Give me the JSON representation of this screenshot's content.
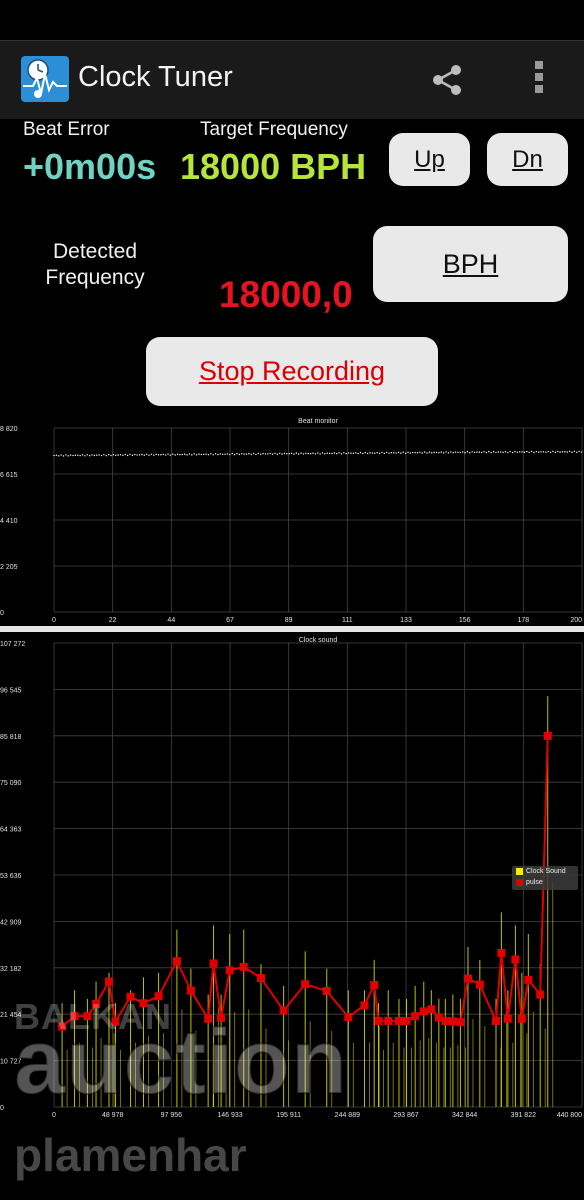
{
  "app": {
    "title": "Clock Tuner",
    "icons": [
      "app-icon",
      "share-icon",
      "overflow-menu-icon"
    ]
  },
  "beat_error": {
    "label": "Beat Error",
    "value": "+0m00s",
    "color": "#6fd3c4"
  },
  "target_frequency": {
    "label": "Target Frequency",
    "value": "18000 BPH",
    "color": "#b5e53a"
  },
  "buttons": {
    "up": "Up",
    "dn": "Dn",
    "bph": "BPH",
    "stop": "Stop Recording"
  },
  "detected_frequency": {
    "label": "Detected Frequency",
    "value": "18000,0",
    "color": "#e8131f"
  },
  "chart_data": [
    {
      "type": "scatter",
      "title": "Beat monitor",
      "y_tick_labels": [
        "0",
        "2 205",
        "4 410",
        "6 615",
        "8 820"
      ],
      "x_tick_labels": [
        "0",
        "22",
        "44",
        "67",
        "89",
        "111",
        "133",
        "156",
        "178",
        "200"
      ],
      "xlim": [
        0,
        200
      ],
      "ylim": [
        0,
        8820
      ],
      "grid": true,
      "series": [
        {
          "color": "#ffffff",
          "x": [
            0,
            20,
            40,
            60,
            80,
            100,
            120,
            140,
            160,
            180,
            200
          ],
          "y": [
            7500,
            7520,
            7540,
            7560,
            7580,
            7600,
            7620,
            7640,
            7660,
            7670,
            7680
          ]
        }
      ]
    },
    {
      "type": "line",
      "title": "Clock sound",
      "y_tick_labels": [
        "0",
        "10 727",
        "21 454",
        "32 182",
        "42 909",
        "53 636",
        "64 363",
        "75 090",
        "85 818",
        "96 545",
        "107 272"
      ],
      "x_tick_labels": [
        "0",
        "48 978",
        "97 956",
        "146 933",
        "195 911",
        "244 889",
        "293 867",
        "342 844",
        "391 822",
        "440 800"
      ],
      "ylim": [
        0,
        107272
      ],
      "xlim": [
        0,
        489778
      ],
      "grid": true,
      "legend": {
        "position": "right",
        "entries": [
          {
            "name": "Clock Sound",
            "color": "#f0f000"
          },
          {
            "name": "pulse",
            "color": "#e00000"
          }
        ]
      },
      "series": [
        {
          "name": "pulse",
          "color": "#e00000",
          "x": [
            7500,
            19000,
            31000,
            39000,
            51000,
            57000,
            71000,
            83000,
            97000,
            114000,
            127000,
            143000,
            148000,
            155000,
            163000,
            176000,
            192000,
            213000,
            233000,
            253000,
            273000,
            288000,
            297000,
            301000,
            310000,
            320000,
            327000,
            335000,
            343000,
            350000,
            357000,
            363000,
            370000,
            377000,
            384000,
            395000,
            410000,
            415000,
            421000,
            428000,
            434000,
            440000,
            451000,
            458000
          ],
          "y": [
            18600,
            21000,
            21000,
            23800,
            29000,
            19700,
            25500,
            24000,
            25600,
            33700,
            26900,
            20400,
            33200,
            20600,
            31600,
            32400,
            29800,
            22300,
            28400,
            26800,
            20800,
            23500,
            28200,
            19900,
            19900,
            19900,
            19900,
            21000,
            22100,
            22600,
            20700,
            19900,
            19800,
            19600,
            29700,
            28300,
            19900,
            35600,
            20400,
            34100,
            20400,
            29400,
            26000,
            85800
          ]
        },
        {
          "name": "Clock Sound",
          "color": "#f0f000",
          "x": [
            7500,
            19000,
            31000,
            39000,
            51000,
            57000,
            71000,
            83000,
            97000,
            114000,
            127000,
            143000,
            148000,
            155000,
            163000,
            176000,
            192000,
            213000,
            233000,
            253000,
            273000,
            288000,
            297000,
            301000,
            310000,
            320000,
            327000,
            335000,
            343000,
            350000,
            357000,
            363000,
            370000,
            377000,
            384000,
            395000,
            410000,
            415000,
            421000,
            428000,
            434000,
            440000,
            451000,
            458000
          ],
          "y": [
            24000,
            27000,
            25000,
            29000,
            31000,
            24000,
            27000,
            30000,
            31000,
            41000,
            32000,
            26000,
            42000,
            26000,
            40000,
            41000,
            33000,
            28000,
            36000,
            32000,
            27000,
            27000,
            34000,
            24000,
            27000,
            25000,
            25000,
            28000,
            29000,
            27000,
            25000,
            25000,
            26000,
            25000,
            37000,
            34000,
            25000,
            45000,
            27000,
            42000,
            31000,
            40000,
            33000,
            95000
          ]
        }
      ]
    }
  ],
  "watermark": {
    "line1": "BALKAN",
    "line2": "auction",
    "line3": "plamenhar"
  }
}
